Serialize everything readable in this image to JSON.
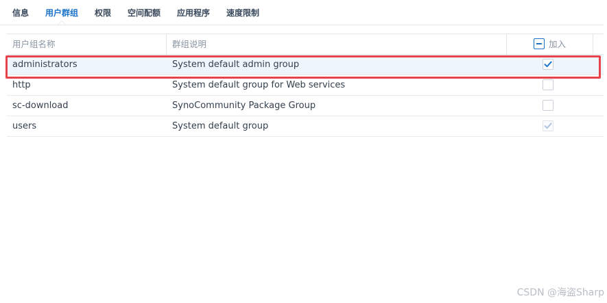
{
  "tabs": [
    {
      "label": "信息"
    },
    {
      "label": "用户群组"
    },
    {
      "label": "权限"
    },
    {
      "label": "空间配额"
    },
    {
      "label": "应用程序"
    },
    {
      "label": "速度限制"
    }
  ],
  "active_tab": 1,
  "table": {
    "columns": [
      "用户组名称",
      "群组说明",
      "加入"
    ],
    "rows": [
      {
        "name": "administrators",
        "description": "System default admin group",
        "joined": "checked"
      },
      {
        "name": "http",
        "description": "System default group for Web services",
        "joined": "unchecked"
      },
      {
        "name": "sc-download",
        "description": "SynoCommunity Package Group",
        "joined": "unchecked"
      },
      {
        "name": "users",
        "description": "System default group",
        "joined": "checked-disabled"
      }
    ],
    "selected_row": 0
  },
  "colors": {
    "accent": "#1a73c9",
    "highlight": "#e8434b",
    "selected_row_bg": "#eef5fc"
  },
  "watermark": "CSDN @海盗Sharp"
}
